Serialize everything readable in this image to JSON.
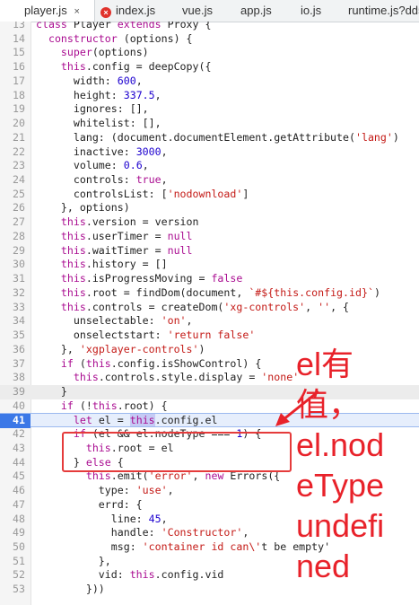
{
  "tabs": [
    {
      "label": "player.js",
      "close": "×",
      "active": true,
      "error": false
    },
    {
      "label": "index.js",
      "close": "",
      "active": false,
      "error": true,
      "error_mark": "×"
    },
    {
      "label": "vue.js",
      "close": "",
      "active": false,
      "error": false
    },
    {
      "label": "app.js",
      "close": "",
      "active": false,
      "error": false
    },
    {
      "label": "io.js",
      "close": "",
      "active": false,
      "error": false
    },
    {
      "label": "runtime.js?dd5",
      "close": "",
      "active": false,
      "error": false
    }
  ],
  "lines": [
    {
      "n": "13",
      "code": "class Player extends Proxy {"
    },
    {
      "n": "14",
      "code": "  constructor (options) {"
    },
    {
      "n": "15",
      "code": "    super(options)"
    },
    {
      "n": "16",
      "code": "    this.config = deepCopy({"
    },
    {
      "n": "17",
      "code": "      width: 600,"
    },
    {
      "n": "18",
      "code": "      height: 337.5,"
    },
    {
      "n": "19",
      "code": "      ignores: [],"
    },
    {
      "n": "20",
      "code": "      whitelist: [],"
    },
    {
      "n": "21",
      "code": "      lang: (document.documentElement.getAttribute('lang')"
    },
    {
      "n": "22",
      "code": "      inactive: 3000,"
    },
    {
      "n": "23",
      "code": "      volume: 0.6,"
    },
    {
      "n": "24",
      "code": "      controls: true,"
    },
    {
      "n": "25",
      "code": "      controlsList: ['nodownload']"
    },
    {
      "n": "26",
      "code": "    }, options)"
    },
    {
      "n": "27",
      "code": "    this.version = version"
    },
    {
      "n": "28",
      "code": "    this.userTimer = null"
    },
    {
      "n": "29",
      "code": "    this.waitTimer = null"
    },
    {
      "n": "30",
      "code": "    this.history = []"
    },
    {
      "n": "31",
      "code": "    this.isProgressMoving = false"
    },
    {
      "n": "32",
      "code": "    this.root = findDom(document, `#${this.config.id}`)"
    },
    {
      "n": "33",
      "code": "    this.controls = createDom('xg-controls', '', {"
    },
    {
      "n": "34",
      "code": "      unselectable: 'on',"
    },
    {
      "n": "35",
      "code": "      onselectstart: 'return false'"
    },
    {
      "n": "36",
      "code": "    }, 'xgplayer-controls')"
    },
    {
      "n": "37",
      "code": "    if (this.config.isShowControl) {"
    },
    {
      "n": "38",
      "code": "      this.controls.style.display = 'none'"
    },
    {
      "n": "39",
      "code": "    }"
    },
    {
      "n": "40",
      "code": "    if (!this.root) {"
    },
    {
      "n": "41",
      "code": "      let el = this.config.el"
    },
    {
      "n": "42",
      "code": "      if (el && el.nodeType === 1) {"
    },
    {
      "n": "43",
      "code": "        this.root = el"
    },
    {
      "n": "44",
      "code": "      } else {"
    },
    {
      "n": "45",
      "code": "        this.emit('error', new Errors({"
    },
    {
      "n": "46",
      "code": "          type: 'use',"
    },
    {
      "n": "47",
      "code": "          errd: {"
    },
    {
      "n": "48",
      "code": "            line: 45,"
    },
    {
      "n": "49",
      "code": "            handle: 'Constructor',"
    },
    {
      "n": "50",
      "code": "            msg: 'container id can\\'t be empty'"
    },
    {
      "n": "51",
      "code": "          },"
    },
    {
      "n": "52",
      "code": "          vid: this.config.vid"
    },
    {
      "n": "53",
      "code": "        }))"
    }
  ],
  "annotation": [
    "el有",
    "值，",
    "el.nod",
    "eType",
    "undefi",
    "ned"
  ],
  "colors": {
    "annotation_red": "#e8222a",
    "current_line": "#e6eefc",
    "line_number_active": "#3b78e7"
  }
}
